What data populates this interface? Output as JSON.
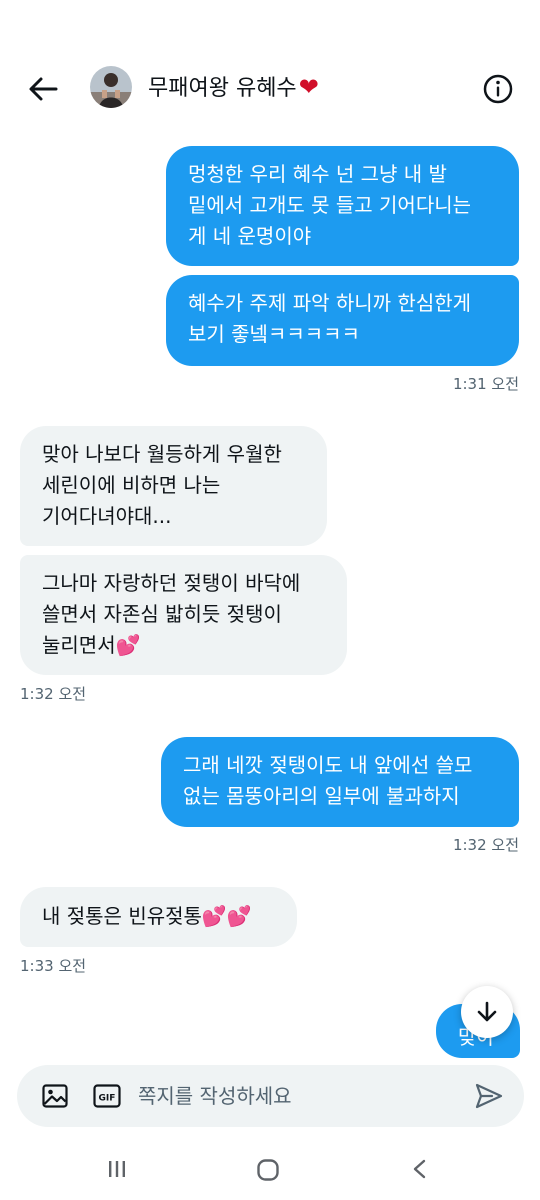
{
  "header": {
    "title": "무패여왕 유혜수",
    "title_emoji": "❤",
    "icons": [
      "arrow-left-icon",
      "avatar",
      "info-icon"
    ]
  },
  "messages": [
    {
      "direction": "sent",
      "lines": [
        "멍청한 우리 혜수 넌 그냥 내 발",
        "밑에서 고개도 못 들고 기어다니는",
        "게 네 운명이야"
      ]
    },
    {
      "direction": "sent",
      "lines": [
        "혜수가 주제 파악 하니까 한심한게",
        "보기 좋넼ㅋㅋㅋㅋㅋ"
      ],
      "time": "1:31 오전"
    },
    {
      "direction": "received",
      "lines": [
        "맞아 나보다 월등하게 우월한",
        "세린이에 비하면 나는",
        "기어다녀야대..."
      ]
    },
    {
      "direction": "received",
      "lines": [
        "그나마 자랑하던 젖탱이 바닥에",
        "쓸면서 자존심 밟히듯 젖탱이",
        "눌리면서💕"
      ],
      "time": "1:32 오전"
    },
    {
      "direction": "sent",
      "lines": [
        "그래 네깟 젖탱이도 내 앞에선 쓸모",
        "없는 몸뚱아리의 일부에 불과하지"
      ],
      "time": "1:32 오전"
    },
    {
      "direction": "received",
      "lines": [
        "내 젖통은 빈유젖통💕💕"
      ],
      "time": "1:33 오전"
    },
    {
      "direction": "sent",
      "lines": [
        "맞아"
      ]
    }
  ],
  "composer": {
    "placeholder": "쪽지를 작성하세요",
    "gif_label": "GIF",
    "icons": [
      "image-icon",
      "gif-icon",
      "send-icon"
    ]
  },
  "system_nav": {
    "icons": [
      "recent-apps-icon",
      "home-icon",
      "back-icon"
    ]
  },
  "colors": {
    "sent_bubble": "#1d9bf0",
    "received_bubble": "#eff3f4",
    "timestamp": "#536471",
    "heart": "#d10f2a"
  }
}
